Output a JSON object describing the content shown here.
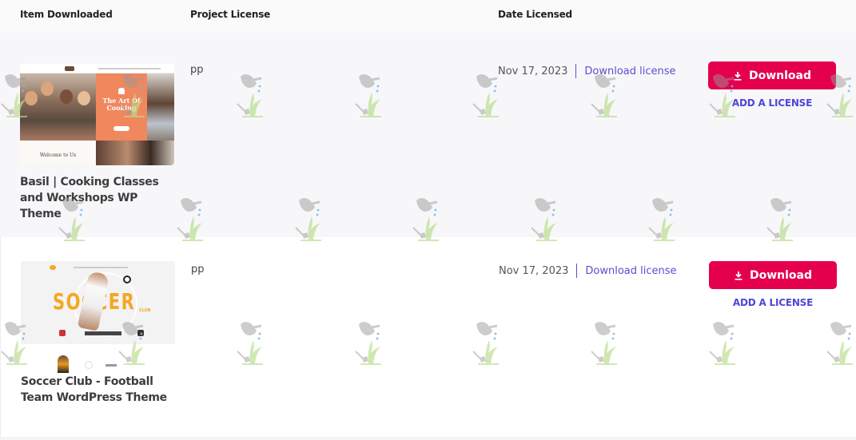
{
  "table": {
    "headers": {
      "item": "Item Downloaded",
      "project_license": "Project License",
      "date_licensed": "Date Licensed"
    },
    "rows": [
      {
        "title": "Basil | Cooking Classes and Workshops WP Theme",
        "thumbnail_texts": {
          "hero": "The Art Of Cooking",
          "welcome": "Welcome to Us"
        },
        "project_license": "pp",
        "date": "Nov 17, 2023",
        "download_license_label": "Download license",
        "download_label": "Download",
        "add_license_label": "ADD A LICENSE"
      },
      {
        "title": "Soccer Club - Football Team WordPress Theme",
        "thumbnail_texts": {
          "hero": "SOCCER",
          "sub": "CLUB"
        },
        "project_license": "pp",
        "date": "Nov 17, 2023",
        "download_license_label": "Download license",
        "download_label": "Download",
        "add_license_label": "ADD A LICENSE"
      }
    ]
  },
  "icons": {
    "download": "download-icon",
    "watermark": "watering-can-plant-watermark"
  },
  "colors": {
    "download_button": "#e5004d",
    "link": "#5a4fcf",
    "add_license": "#4f46d8",
    "header_text": "#222222"
  }
}
